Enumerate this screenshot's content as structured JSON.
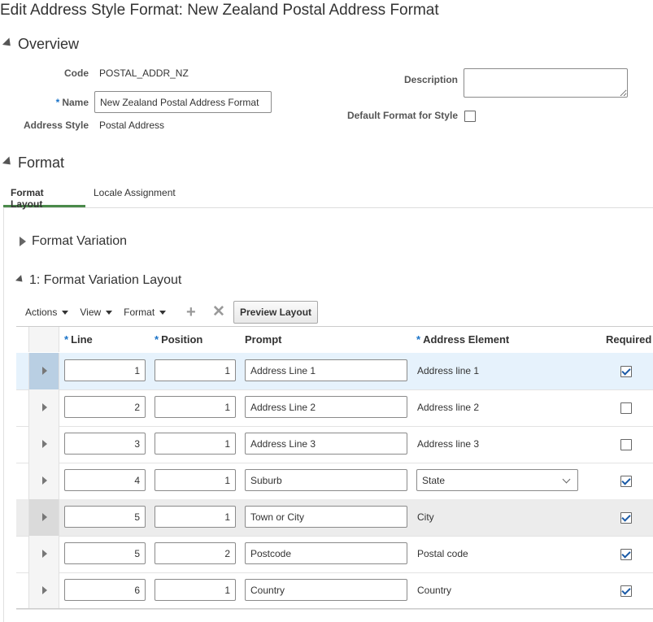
{
  "page": {
    "title": "Edit Address Style Format: New Zealand Postal Address Format"
  },
  "overview": {
    "heading": "Overview",
    "code_label": "Code",
    "code_value": "POSTAL_ADDR_NZ",
    "name_label": "Name",
    "name_value": "New Zealand Postal Address Format",
    "style_label": "Address Style",
    "style_value": "Postal Address",
    "description_label": "Description",
    "description_value": "",
    "default_label": "Default Format for Style",
    "default_checked": false,
    "required_marker": "*"
  },
  "format": {
    "heading": "Format",
    "tabs": [
      {
        "label": "Format Layout",
        "active": true
      },
      {
        "label": "Locale Assignment",
        "active": false
      }
    ],
    "variation_heading": "Format Variation",
    "layout_heading": "1: Format Variation Layout"
  },
  "toolbar": {
    "actions_label": "Actions",
    "view_label": "View",
    "format_label": "Format",
    "add_icon": "plus-icon",
    "delete_icon": "delete-x-icon",
    "preview_label": "Preview Layout"
  },
  "table": {
    "columns": {
      "line": "Line",
      "position": "Position",
      "prompt": "Prompt",
      "address_element": "Address Element",
      "required": "Required"
    },
    "rows": [
      {
        "line": "1",
        "position": "1",
        "prompt": "Address Line 1",
        "element": "Address line 1",
        "required": true,
        "selected": true
      },
      {
        "line": "2",
        "position": "1",
        "prompt": "Address Line 2",
        "element": "Address line 2",
        "required": false
      },
      {
        "line": "3",
        "position": "1",
        "prompt": "Address Line 3",
        "element": "Address line 3",
        "required": false
      },
      {
        "line": "4",
        "position": "1",
        "prompt": "Suburb",
        "element": "State",
        "required": true,
        "editable_element": true
      },
      {
        "line": "5",
        "position": "1",
        "prompt": "Town or City",
        "element": "City",
        "required": true,
        "hover": true
      },
      {
        "line": "5",
        "position": "2",
        "prompt": "Postcode",
        "element": "Postal code",
        "required": true
      },
      {
        "line": "6",
        "position": "1",
        "prompt": "Country",
        "element": "Country",
        "required": true
      }
    ]
  },
  "colors": {
    "accent": "#1a73c8",
    "selected_row": "#e6f2fc",
    "active_tab": "#4a8a4a"
  }
}
